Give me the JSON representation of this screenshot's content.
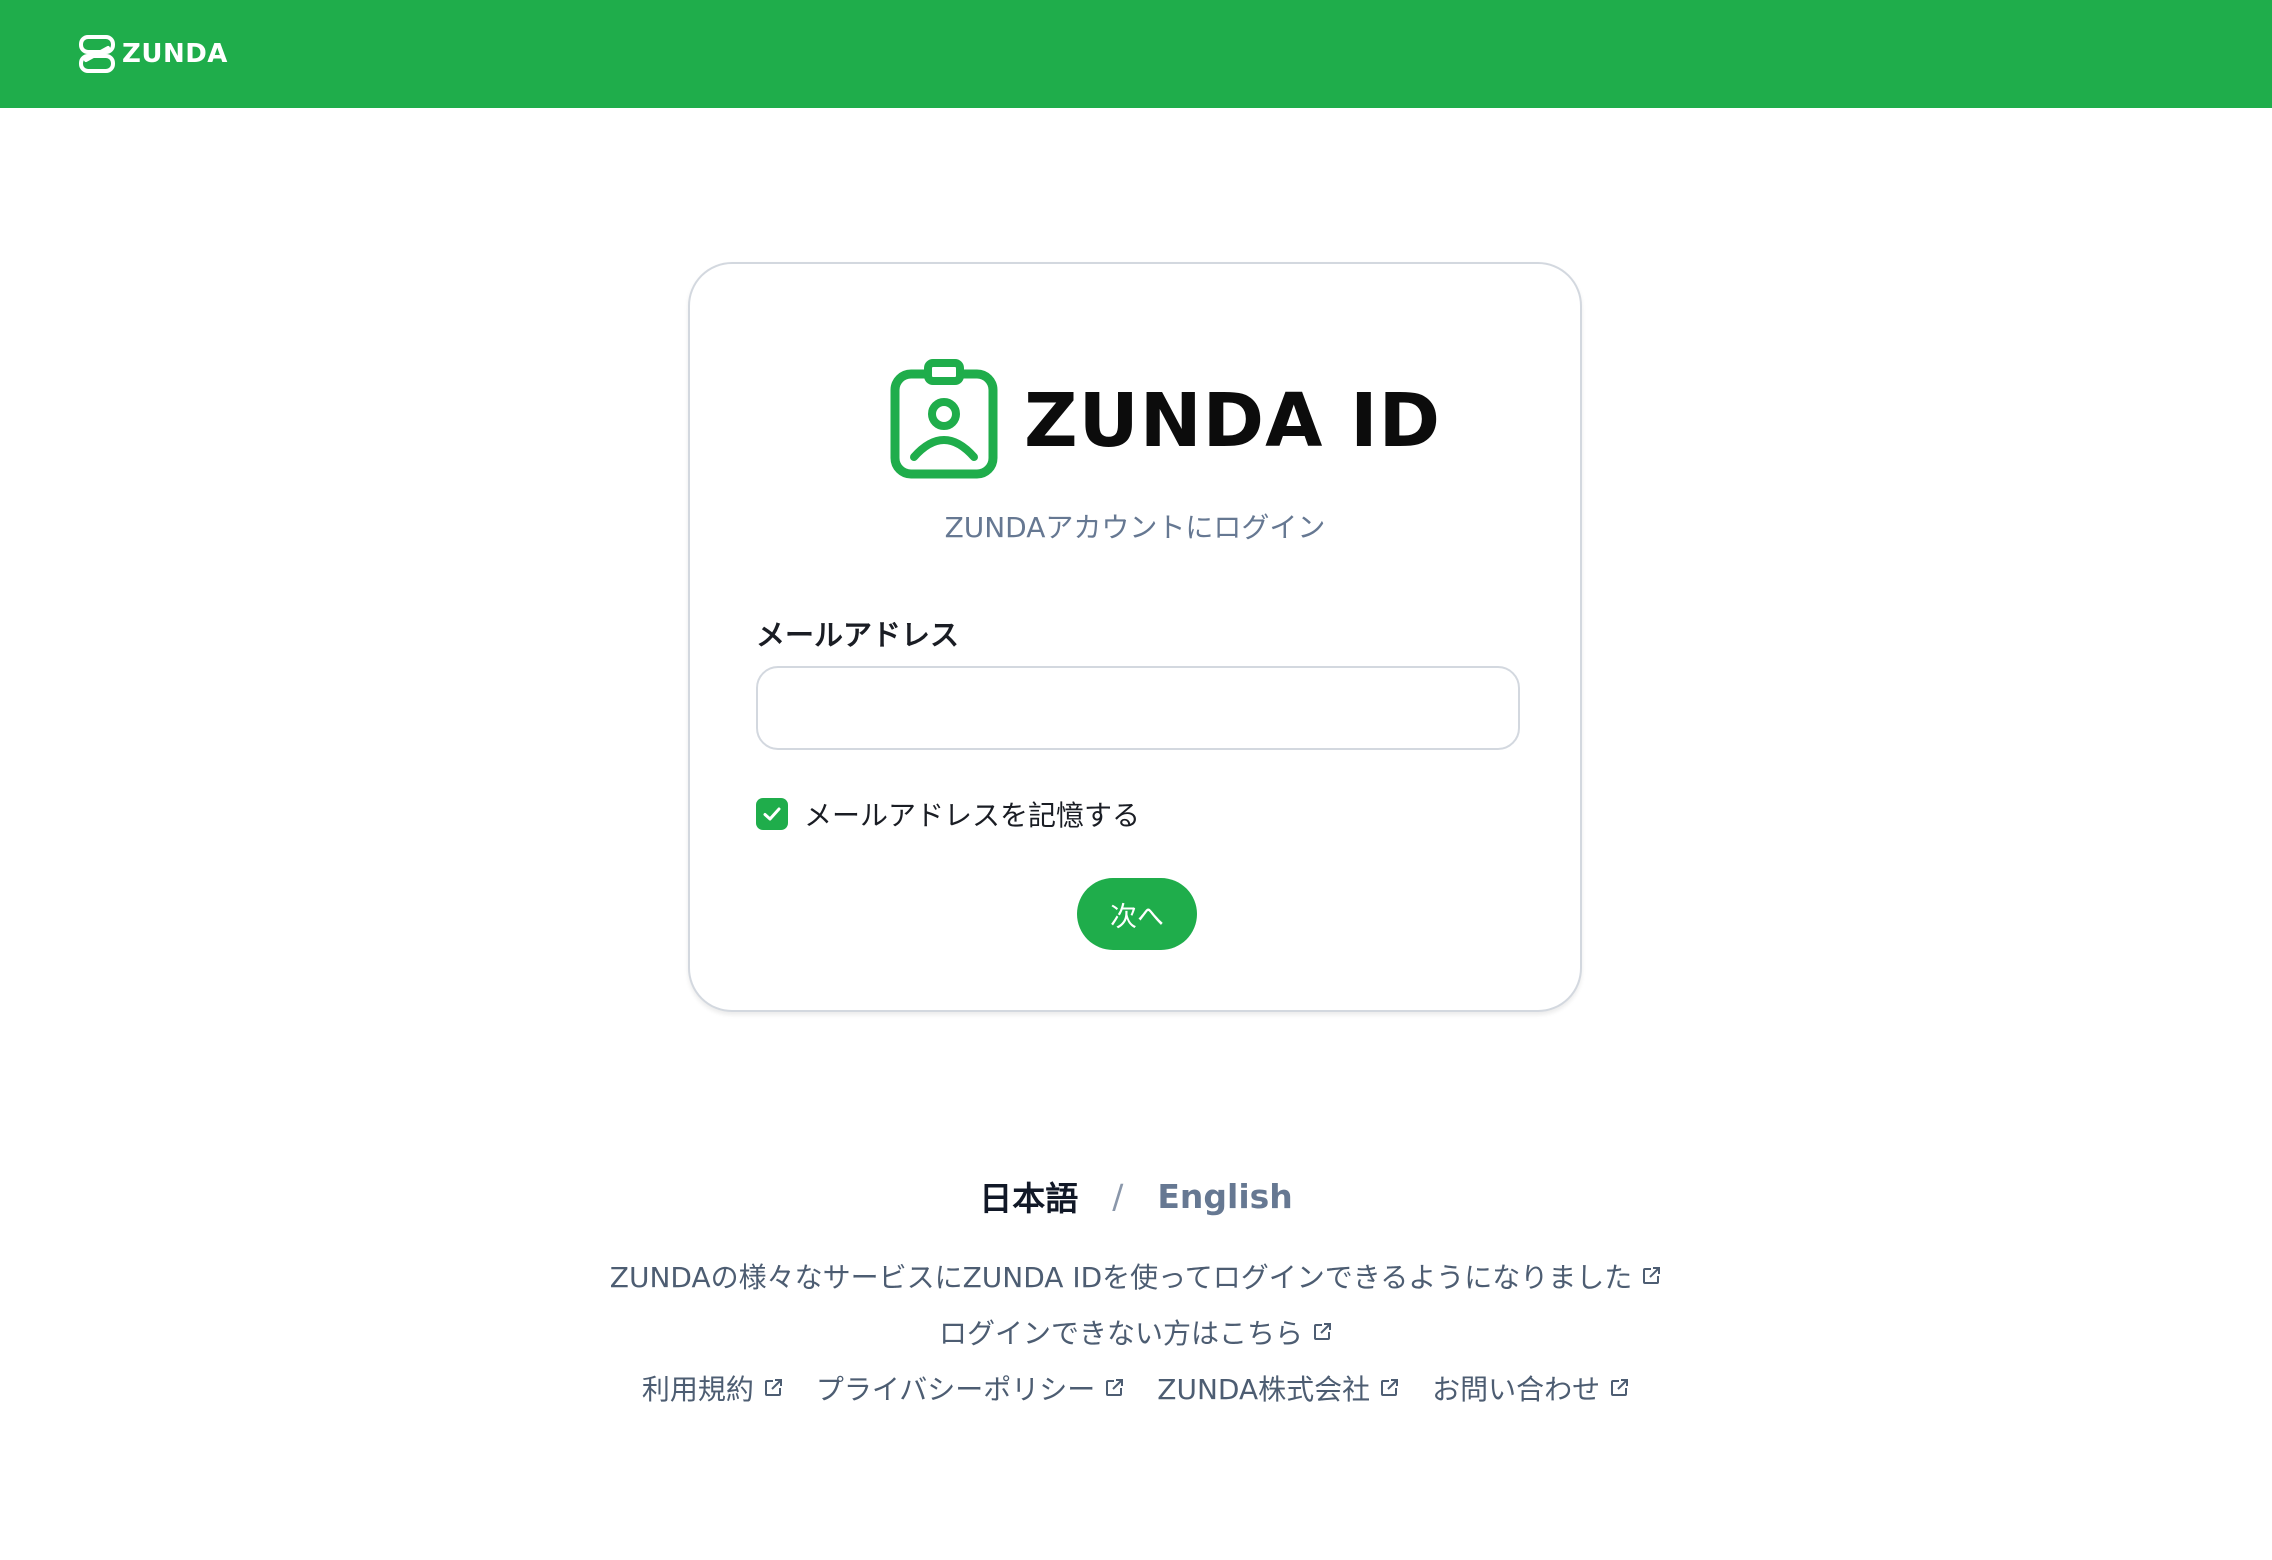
{
  "header": {
    "logo_text": "ZUNDA",
    "background_color": "#1fad4b"
  },
  "card": {
    "brand_text": "ZUNDA ID",
    "subtitle": "ZUNDAアカウントにログイン",
    "email_label": "メールアドレス",
    "email_value": "",
    "email_placeholder": "",
    "remember_label": "メールアドレスを記憶する",
    "remember_checked": true,
    "next_button_label": "次へ"
  },
  "language": {
    "japanese": "日本語",
    "separator": "/",
    "english": "English",
    "active": "日本語"
  },
  "footer": {
    "announcement_link": "ZUNDAの様々なサービスにZUNDA IDを使ってログインできるようになりました",
    "help_link": "ログインできない方はこちら",
    "links": [
      {
        "label": "利用規約"
      },
      {
        "label": "プライバシーポリシー"
      },
      {
        "label": "ZUNDA株式会社"
      },
      {
        "label": "お問い合わせ"
      }
    ]
  },
  "icons": {
    "header_logo": "zunda-logo-icon",
    "brand_logo": "id-badge-icon",
    "checkbox": "check-icon",
    "external_link": "external-link-icon"
  },
  "colors": {
    "accent": "#1fad4b",
    "muted_text": "#667892",
    "border": "#d3d8df"
  }
}
